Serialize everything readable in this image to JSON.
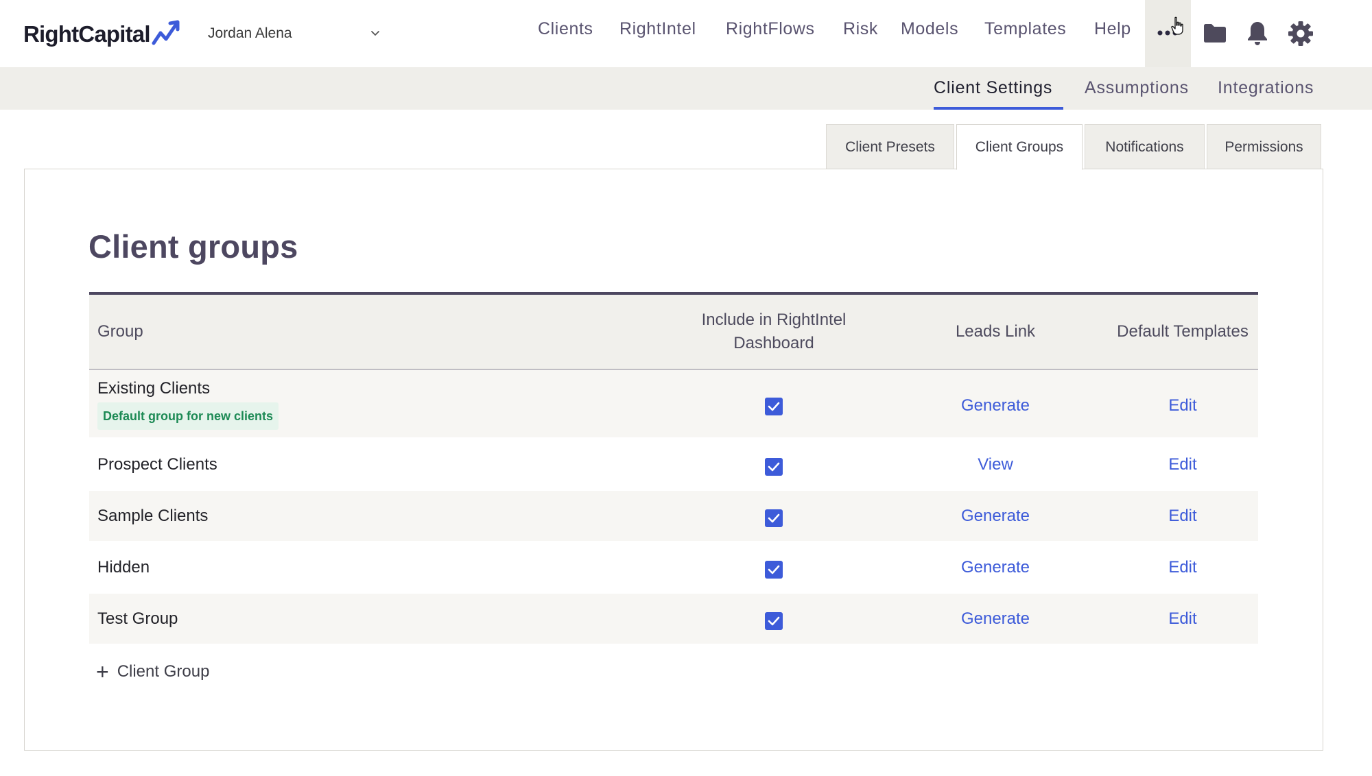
{
  "brand": {
    "name": "RightCapital",
    "accent": "#3d5bd9"
  },
  "user": {
    "name": "Jordan Alena"
  },
  "main_nav": [
    "Clients",
    "RightIntel",
    "RightFlows",
    "Risk",
    "Models",
    "Templates",
    "Help"
  ],
  "toolbar_icons": [
    "more-icon",
    "folder-icon",
    "bell-icon",
    "gear-icon"
  ],
  "sub_nav": {
    "items": [
      "Client Settings",
      "Assumptions",
      "Integrations"
    ],
    "active": "Client Settings"
  },
  "tabs": {
    "items": [
      "Client Presets",
      "Client Groups",
      "Notifications",
      "Permissions"
    ],
    "active": "Client Groups"
  },
  "page": {
    "title": "Client groups"
  },
  "table": {
    "headers": {
      "group": "Group",
      "dashboard_line1": "Include in RightIntel",
      "dashboard_line2": "Dashboard",
      "leads": "Leads Link",
      "templates": "Default Templates"
    },
    "rows": [
      {
        "group": "Existing Clients",
        "badge": "Default group for new clients",
        "dashboard": true,
        "leads": "Generate",
        "templates": "Edit"
      },
      {
        "group": "Prospect Clients",
        "dashboard": true,
        "leads": "View",
        "templates": "Edit"
      },
      {
        "group": "Sample Clients",
        "dashboard": true,
        "leads": "Generate",
        "templates": "Edit"
      },
      {
        "group": "Hidden",
        "dashboard": true,
        "leads": "Generate",
        "templates": "Edit"
      },
      {
        "group": "Test Group",
        "dashboard": true,
        "leads": "Generate",
        "templates": "Edit"
      }
    ]
  },
  "add_button": {
    "label": "Client Group"
  }
}
